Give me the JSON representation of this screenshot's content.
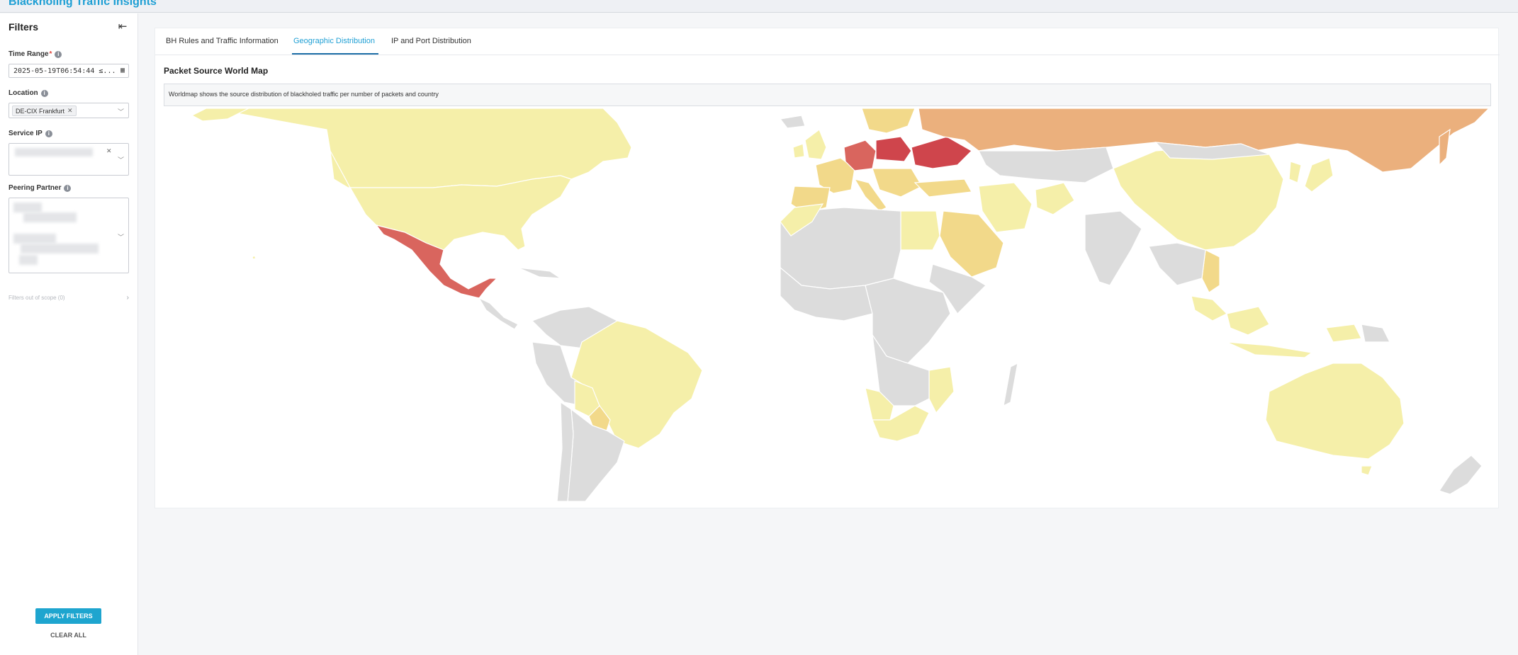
{
  "app": {
    "title": "Blackholing Traffic Insights"
  },
  "filters": {
    "title": "Filters",
    "time_range": {
      "label": "Time Range",
      "required_mark": "*",
      "value": "2025-05-19T06:54:44 ≤..."
    },
    "location": {
      "label": "Location",
      "selected": "DE-CIX Frankfurt"
    },
    "service_ip": {
      "label": "Service IP"
    },
    "peering_partner": {
      "label": "Peering Partner"
    },
    "out_of_scope": "Filters out of scope (0)",
    "apply_label": "APPLY FILTERS",
    "clear_label": "CLEAR ALL"
  },
  "tabs": [
    {
      "label": "BH Rules and Traffic Information"
    },
    {
      "label": "Geographic Distribution",
      "active": true
    },
    {
      "label": "IP and Port Distribution"
    }
  ],
  "map": {
    "title": "Packet Source World Map",
    "description": "Worldmap shows the source distribution of blackholed traffic per number of packets and country",
    "scale_colors": [
      "#dcdcdc",
      "#f5efa9",
      "#f2d98a",
      "#ebb07d",
      "#d9655e",
      "#cf454c"
    ]
  },
  "colors": {
    "accent": "#1ea5cf",
    "tab_active": "#1e9fd4"
  }
}
